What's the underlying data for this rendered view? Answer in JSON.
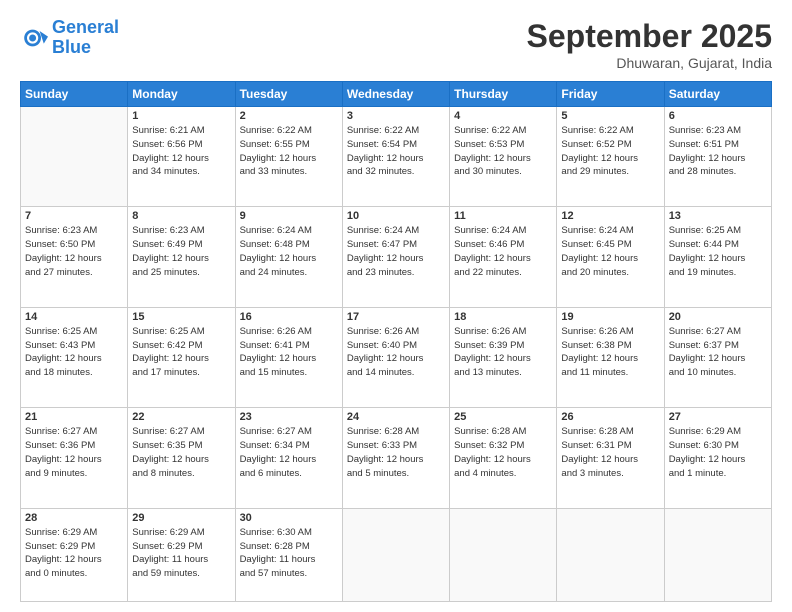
{
  "logo": {
    "line1": "General",
    "line2": "Blue"
  },
  "title": "September 2025",
  "location": "Dhuwaran, Gujarat, India",
  "days_header": [
    "Sunday",
    "Monday",
    "Tuesday",
    "Wednesday",
    "Thursday",
    "Friday",
    "Saturday"
  ],
  "weeks": [
    [
      {
        "day": "",
        "info": ""
      },
      {
        "day": "1",
        "info": "Sunrise: 6:21 AM\nSunset: 6:56 PM\nDaylight: 12 hours\nand 34 minutes."
      },
      {
        "day": "2",
        "info": "Sunrise: 6:22 AM\nSunset: 6:55 PM\nDaylight: 12 hours\nand 33 minutes."
      },
      {
        "day": "3",
        "info": "Sunrise: 6:22 AM\nSunset: 6:54 PM\nDaylight: 12 hours\nand 32 minutes."
      },
      {
        "day": "4",
        "info": "Sunrise: 6:22 AM\nSunset: 6:53 PM\nDaylight: 12 hours\nand 30 minutes."
      },
      {
        "day": "5",
        "info": "Sunrise: 6:22 AM\nSunset: 6:52 PM\nDaylight: 12 hours\nand 29 minutes."
      },
      {
        "day": "6",
        "info": "Sunrise: 6:23 AM\nSunset: 6:51 PM\nDaylight: 12 hours\nand 28 minutes."
      }
    ],
    [
      {
        "day": "7",
        "info": "Sunrise: 6:23 AM\nSunset: 6:50 PM\nDaylight: 12 hours\nand 27 minutes."
      },
      {
        "day": "8",
        "info": "Sunrise: 6:23 AM\nSunset: 6:49 PM\nDaylight: 12 hours\nand 25 minutes."
      },
      {
        "day": "9",
        "info": "Sunrise: 6:24 AM\nSunset: 6:48 PM\nDaylight: 12 hours\nand 24 minutes."
      },
      {
        "day": "10",
        "info": "Sunrise: 6:24 AM\nSunset: 6:47 PM\nDaylight: 12 hours\nand 23 minutes."
      },
      {
        "day": "11",
        "info": "Sunrise: 6:24 AM\nSunset: 6:46 PM\nDaylight: 12 hours\nand 22 minutes."
      },
      {
        "day": "12",
        "info": "Sunrise: 6:24 AM\nSunset: 6:45 PM\nDaylight: 12 hours\nand 20 minutes."
      },
      {
        "day": "13",
        "info": "Sunrise: 6:25 AM\nSunset: 6:44 PM\nDaylight: 12 hours\nand 19 minutes."
      }
    ],
    [
      {
        "day": "14",
        "info": "Sunrise: 6:25 AM\nSunset: 6:43 PM\nDaylight: 12 hours\nand 18 minutes."
      },
      {
        "day": "15",
        "info": "Sunrise: 6:25 AM\nSunset: 6:42 PM\nDaylight: 12 hours\nand 17 minutes."
      },
      {
        "day": "16",
        "info": "Sunrise: 6:26 AM\nSunset: 6:41 PM\nDaylight: 12 hours\nand 15 minutes."
      },
      {
        "day": "17",
        "info": "Sunrise: 6:26 AM\nSunset: 6:40 PM\nDaylight: 12 hours\nand 14 minutes."
      },
      {
        "day": "18",
        "info": "Sunrise: 6:26 AM\nSunset: 6:39 PM\nDaylight: 12 hours\nand 13 minutes."
      },
      {
        "day": "19",
        "info": "Sunrise: 6:26 AM\nSunset: 6:38 PM\nDaylight: 12 hours\nand 11 minutes."
      },
      {
        "day": "20",
        "info": "Sunrise: 6:27 AM\nSunset: 6:37 PM\nDaylight: 12 hours\nand 10 minutes."
      }
    ],
    [
      {
        "day": "21",
        "info": "Sunrise: 6:27 AM\nSunset: 6:36 PM\nDaylight: 12 hours\nand 9 minutes."
      },
      {
        "day": "22",
        "info": "Sunrise: 6:27 AM\nSunset: 6:35 PM\nDaylight: 12 hours\nand 8 minutes."
      },
      {
        "day": "23",
        "info": "Sunrise: 6:27 AM\nSunset: 6:34 PM\nDaylight: 12 hours\nand 6 minutes."
      },
      {
        "day": "24",
        "info": "Sunrise: 6:28 AM\nSunset: 6:33 PM\nDaylight: 12 hours\nand 5 minutes."
      },
      {
        "day": "25",
        "info": "Sunrise: 6:28 AM\nSunset: 6:32 PM\nDaylight: 12 hours\nand 4 minutes."
      },
      {
        "day": "26",
        "info": "Sunrise: 6:28 AM\nSunset: 6:31 PM\nDaylight: 12 hours\nand 3 minutes."
      },
      {
        "day": "27",
        "info": "Sunrise: 6:29 AM\nSunset: 6:30 PM\nDaylight: 12 hours\nand 1 minute."
      }
    ],
    [
      {
        "day": "28",
        "info": "Sunrise: 6:29 AM\nSunset: 6:29 PM\nDaylight: 12 hours\nand 0 minutes."
      },
      {
        "day": "29",
        "info": "Sunrise: 6:29 AM\nSunset: 6:29 PM\nDaylight: 11 hours\nand 59 minutes."
      },
      {
        "day": "30",
        "info": "Sunrise: 6:30 AM\nSunset: 6:28 PM\nDaylight: 11 hours\nand 57 minutes."
      },
      {
        "day": "",
        "info": ""
      },
      {
        "day": "",
        "info": ""
      },
      {
        "day": "",
        "info": ""
      },
      {
        "day": "",
        "info": ""
      }
    ]
  ]
}
